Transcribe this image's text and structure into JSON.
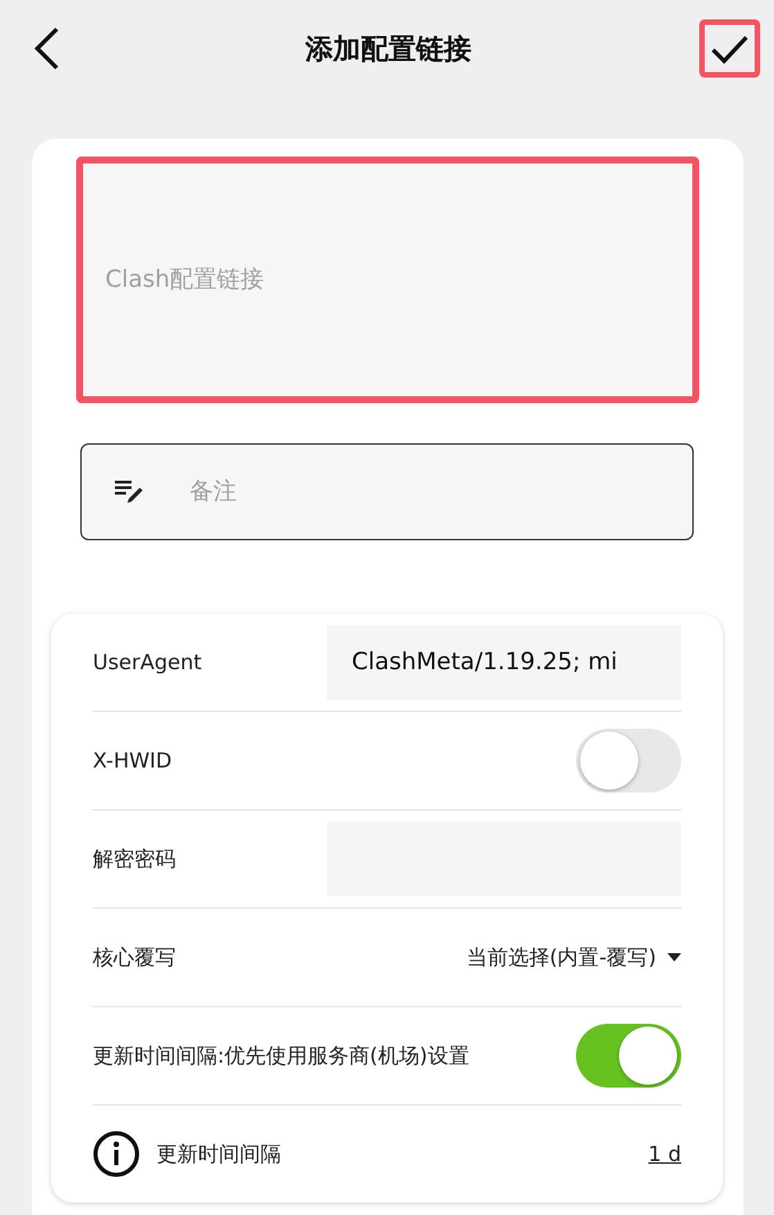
{
  "header": {
    "title": "添加配置链接",
    "confirm_highlighted": true
  },
  "link_field": {
    "placeholder": "Clash配置链接",
    "highlighted": true
  },
  "note_field": {
    "placeholder": "备注"
  },
  "settings": [
    {
      "kind": "input",
      "label": "UserAgent",
      "value": "ClashMeta/1.19.25; mi"
    },
    {
      "kind": "switch",
      "label": "X-HWID",
      "on": false
    },
    {
      "kind": "input",
      "label": "解密密码"
    },
    {
      "kind": "dropdown",
      "label": "核心覆写",
      "value": "当前选择(内置-覆写)"
    },
    {
      "kind": "switch",
      "label": "更新时间间隔:优先使用服务商(机场)设置",
      "on": true
    },
    {
      "kind": "info",
      "label": "更新时间间隔",
      "value": "1 d"
    }
  ]
}
